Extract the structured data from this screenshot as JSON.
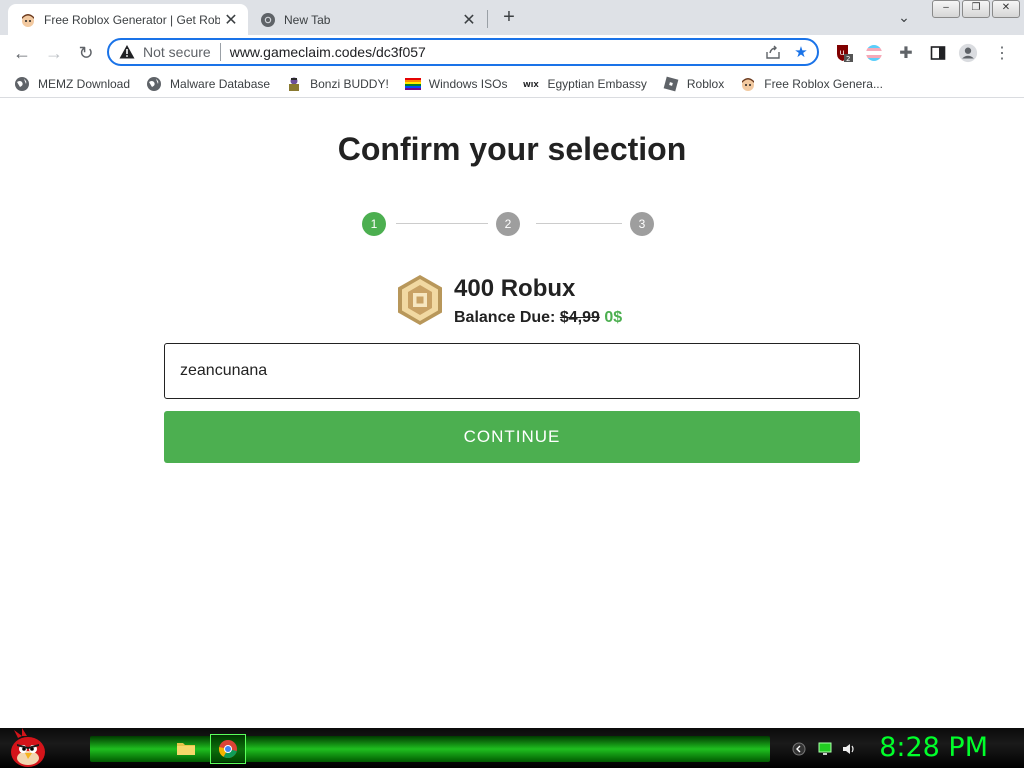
{
  "browser": {
    "tabs": [
      {
        "title": "Free Roblox Generator | Get Robux",
        "active": true
      },
      {
        "title": "New Tab",
        "active": false
      }
    ],
    "address_bar": {
      "security_label": "Not secure",
      "url": "www.gameclaim.codes/dc3f057"
    },
    "extension_badge": "2",
    "bookmarks": [
      {
        "label": "MEMZ Download",
        "icon": "globe-icon"
      },
      {
        "label": "Malware Database",
        "icon": "globe-icon"
      },
      {
        "label": "Bonzi BUDDY!",
        "icon": "bonzi-icon"
      },
      {
        "label": "Windows ISOs",
        "icon": "rainbow-flag-icon"
      },
      {
        "label": "Egyptian Embassy",
        "icon": "wix-icon"
      },
      {
        "label": "Roblox",
        "icon": "roblox-icon"
      },
      {
        "label": "Free Roblox Genera...",
        "icon": "roblox-avatar-icon"
      }
    ]
  },
  "page": {
    "title": "Confirm your selection",
    "steps": [
      "1",
      "2",
      "3"
    ],
    "active_step": 1,
    "product_name": "400 Robux",
    "balance_label": "Balance Due:",
    "old_price": "$4,99",
    "new_price": "0$",
    "username_value": "zeancunana",
    "continue_label": "CONTINUE"
  },
  "taskbar": {
    "clock": "8:28 PM"
  },
  "colors": {
    "accent_green": "#4caf50",
    "step_inactive": "#9e9e9e",
    "omnibox_focus": "#1a73e8",
    "clock_green": "#00ff2a"
  }
}
